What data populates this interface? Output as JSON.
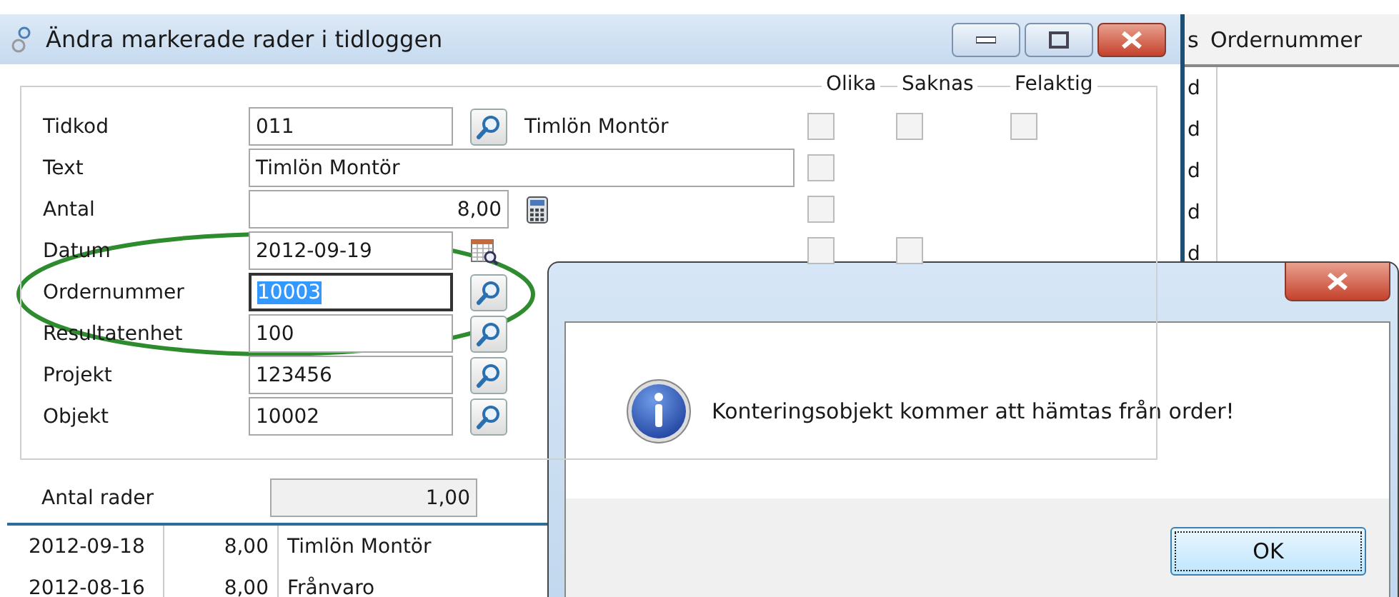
{
  "window": {
    "title": "Ändra markerade rader i tidloggen"
  },
  "check_columns": [
    "Olika",
    "Saknas",
    "Felaktig"
  ],
  "fields": [
    {
      "label": "Tidkod",
      "kind": "code",
      "value": "011",
      "button": {
        "kind": "lookup"
      },
      "description": "Timlön Montör",
      "focused": false,
      "checks": [
        {
          "kind": "checkbox",
          "checked": false
        },
        {
          "kind": "checkbox",
          "checked": false
        },
        {
          "kind": "checkbox",
          "checked": false
        }
      ]
    },
    {
      "label": "Text",
      "kind": "text",
      "value": "Timlön Montör",
      "focused": false,
      "checks": [
        {
          "kind": "checkbox",
          "checked": false
        },
        {
          "kind": "blank"
        },
        {
          "kind": "blank"
        }
      ]
    },
    {
      "label": "Antal",
      "kind": "number",
      "value": "8,00",
      "button": {
        "kind": "calculator"
      },
      "focused": false,
      "checks": [
        {
          "kind": "checkbox",
          "checked": false
        },
        {
          "kind": "blank"
        },
        {
          "kind": "blank"
        }
      ]
    },
    {
      "label": "Datum",
      "kind": "code",
      "value": "2012-09-19",
      "button": {
        "kind": "calendar"
      },
      "focused": false,
      "checks": [
        {
          "kind": "checkbox",
          "checked": false
        },
        {
          "kind": "checkbox",
          "checked": false
        },
        {
          "kind": "blank"
        }
      ]
    },
    {
      "label": "Ordernummer",
      "kind": "code",
      "value": "10003",
      "button": {
        "kind": "lookup"
      },
      "focused": true
    },
    {
      "label": "Resultatenhet",
      "kind": "code",
      "value": "100",
      "button": {
        "kind": "lookup"
      },
      "focused": false
    },
    {
      "label": "Projekt",
      "kind": "code",
      "value": "123456",
      "button": {
        "kind": "lookup"
      },
      "focused": false
    },
    {
      "label": "Objekt",
      "kind": "code",
      "value": "10002",
      "button": {
        "kind": "lookup"
      },
      "focused": false
    }
  ],
  "summary": {
    "label": "Antal rader",
    "value": "1,00"
  },
  "log_rows": [
    {
      "date": "2012-09-18",
      "amount": "8,00",
      "text": "Timlön Montör"
    },
    {
      "date": "2012-08-16",
      "amount": "8,00",
      "text": "Frånvaro"
    }
  ],
  "background_list": {
    "headers": [
      "s",
      "Ordernummer"
    ],
    "rows": [
      "d",
      "d",
      "d",
      "d",
      "d"
    ]
  },
  "message": {
    "text": "Konteringsobjekt kommer att hämtas från order!",
    "buttons": [
      {
        "label": "OK",
        "focused": true
      }
    ]
  }
}
